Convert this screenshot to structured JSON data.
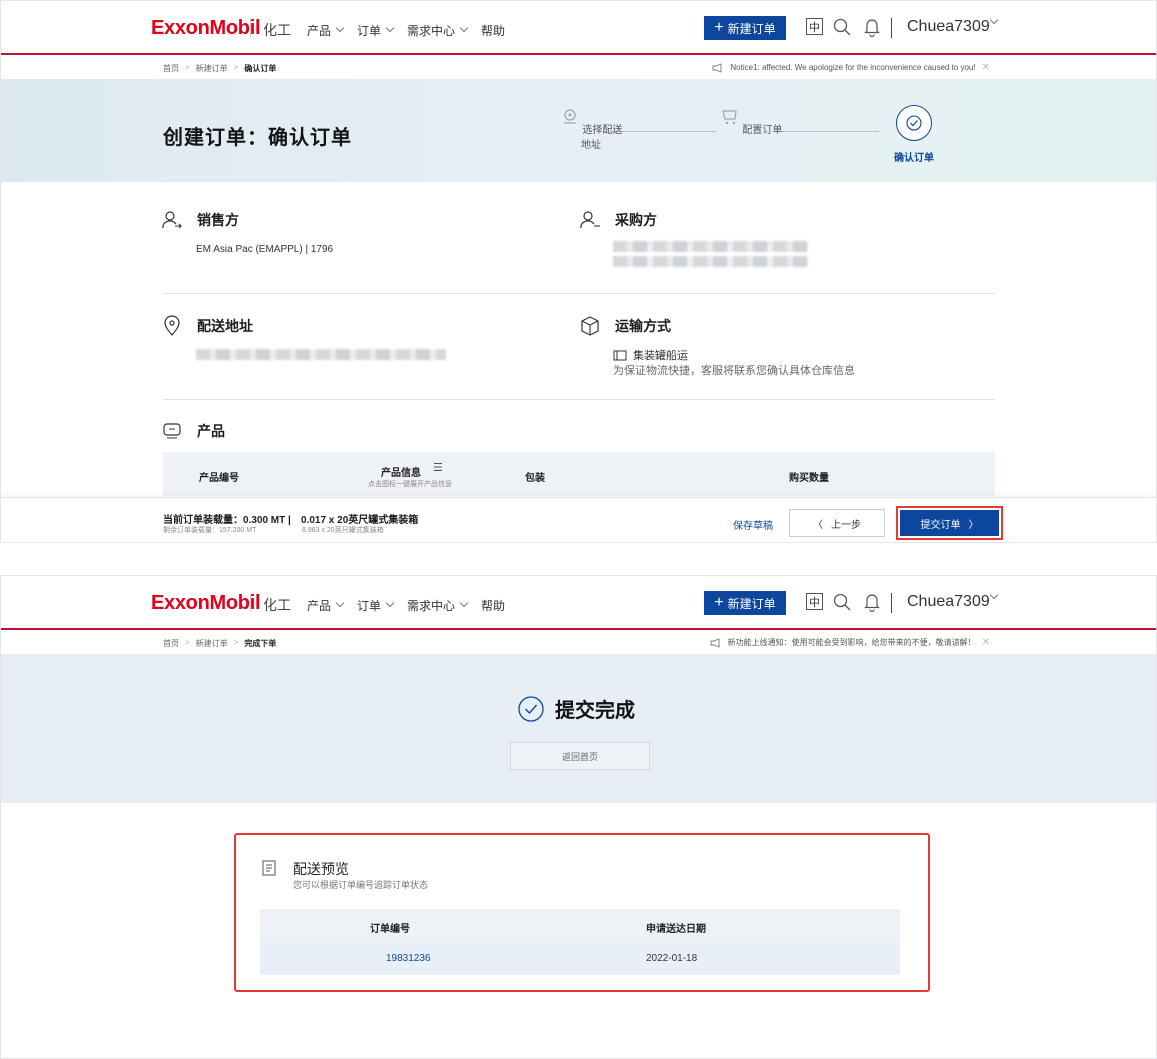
{
  "header": {
    "logo": "ExxonMobil",
    "nav": [
      {
        "label": "化工",
        "dropdown": false
      },
      {
        "label": "产品",
        "dropdown": true
      },
      {
        "label": "订单",
        "dropdown": true
      },
      {
        "label": "需求中心",
        "dropdown": true
      },
      {
        "label": "帮助",
        "dropdown": false
      }
    ],
    "new_order": "新建订单",
    "lang": "中",
    "user": "Chuea7309"
  },
  "confirm_page": {
    "breadcrumb": [
      "首页",
      "新建订单",
      "确认订单"
    ],
    "notice": "Notice1:  affected. We apologize for the inconvenience caused to you!",
    "title": "创建订单：确认订单",
    "steps": [
      "选择配送地址",
      "配置订单",
      "确认订单"
    ],
    "seller": {
      "label": "销售方",
      "value": "EM Asia Pac (EMAPPL) | 1796"
    },
    "buyer": {
      "label": "采购方"
    },
    "address": {
      "label": "配送地址"
    },
    "shipping": {
      "label": "运输方式",
      "method": "集装罐船运",
      "note": "为保证物流快捷，客服将联系您确认具体仓库信息"
    },
    "products": {
      "label": "产品",
      "columns": [
        "产品编号",
        "产品信息",
        "包装",
        "购买数量"
      ],
      "info_hint": "点击图标一键展开产品信息"
    },
    "footer": {
      "current_load": "当前订单装载量：0.300 MT |",
      "remaining_load": "剩余订单装载量：157.200 MT",
      "container": "0.017 x 20英尺罐式集装箱",
      "container_remaining": "8.983 x 20英尺罐式集装箱",
      "save_draft": "保存草稿",
      "prev": "上一步",
      "submit": "提交订单"
    }
  },
  "done_page": {
    "breadcrumb": [
      "首页",
      "新建订单",
      "完成下单"
    ],
    "notice": "新功能上线通知：使用可能会受到影响，给您带来的不便，敬请谅解！",
    "title": "提交完成",
    "home_btn": "返回首页",
    "preview": {
      "title": "配送预览",
      "subtitle": "您可以根据订单编号追踪订单状态",
      "columns": [
        "订单编号",
        "申请送达日期"
      ],
      "rows": [
        {
          "order_no": "19831236",
          "date": "2022-01-18"
        }
      ]
    }
  },
  "colors": {
    "brand_red": "#e2001a",
    "primary_blue": "#0c479d",
    "highlight_red": "#e53935"
  }
}
